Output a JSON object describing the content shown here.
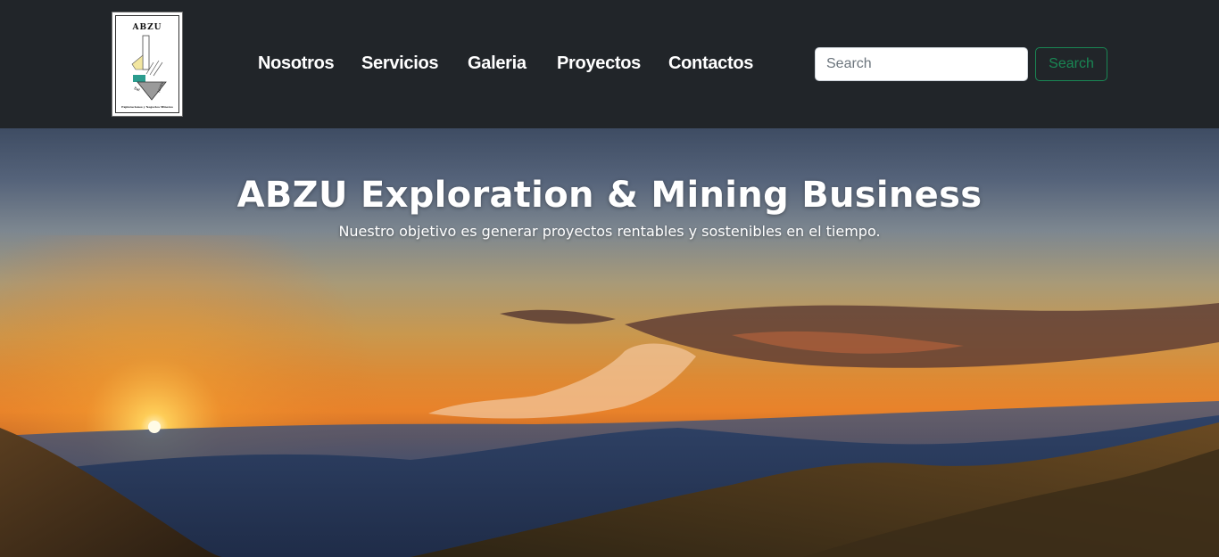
{
  "brand": {
    "logo_icon": "abzu-logo-icon",
    "logo_title": "ABZU",
    "logo_caption": "Exploraciones y Negocios Mineros"
  },
  "nav": {
    "links": [
      {
        "label": "Nosotros"
      },
      {
        "label": "Servicios"
      },
      {
        "label": "Galeria"
      },
      {
        "label": "Proyectos"
      },
      {
        "label": "Contactos"
      }
    ]
  },
  "search": {
    "placeholder": "Search",
    "value": "",
    "button_label": "Search"
  },
  "hero": {
    "title": "ABZU Exploration & Mining Business",
    "subtitle": "Nuestro objetivo es generar proyectos rentables y sostenibles en el tiempo.",
    "background_image": "sunset-mountains-photo"
  },
  "colors": {
    "navbar_bg": "#212529",
    "nav_text": "#ffffff",
    "accent_green": "#198754"
  }
}
